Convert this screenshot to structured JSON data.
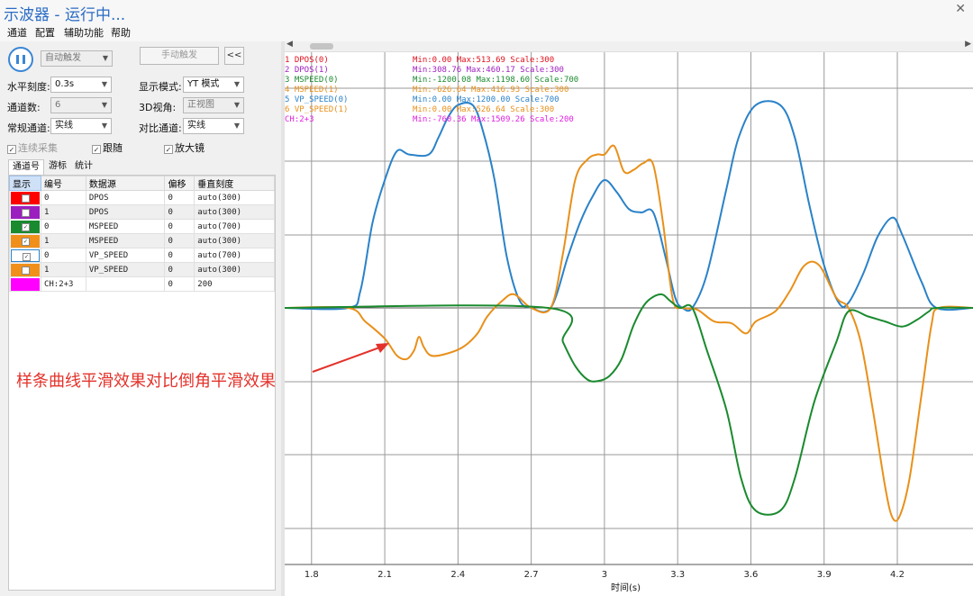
{
  "window": {
    "title": "示波器 - 运行中..."
  },
  "menu": [
    "通道",
    "配置",
    "辅助功能",
    "帮助"
  ],
  "controls": {
    "trigger_mode": "自动触发",
    "manual_trigger": "手动触发",
    "collapse": "<<",
    "h_scale_label": "水平刻度:",
    "h_scale_value": "0.3s",
    "display_mode_label": "显示模式:",
    "display_mode_value": "YT 模式",
    "channels_label": "通道数:",
    "channels_value": "6",
    "view3d_label": "3D视角:",
    "view3d_value": "正视图",
    "normal_ch_label": "常规通道:",
    "normal_ch_value": "实线",
    "compare_ch_label": "对比通道:",
    "compare_ch_value": "实线",
    "continuous": "连续采集",
    "follow": "跟随",
    "magnifier": "放大镜"
  },
  "tabs": [
    "通道号",
    "游标",
    "统计"
  ],
  "table": {
    "headers": [
      "显示",
      "编号",
      "数据源",
      "偏移",
      "垂直刻度"
    ],
    "rows": [
      {
        "color": "#ff0000",
        "checked": false,
        "num": "0",
        "source": "DPOS",
        "offset": "0",
        "scale": "auto(300)"
      },
      {
        "color": "#9b1fbf",
        "checked": false,
        "num": "1",
        "source": "DPOS",
        "offset": "0",
        "scale": "auto(300)"
      },
      {
        "color": "#1a8a2e",
        "checked": true,
        "num": "0",
        "source": "MSPEED",
        "offset": "0",
        "scale": "auto(700)"
      },
      {
        "color": "#f0901a",
        "checked": true,
        "num": "1",
        "source": "MSPEED",
        "offset": "0",
        "scale": "auto(300)"
      },
      {
        "color": "#ffffff",
        "checked": true,
        "num": "0",
        "source": "VP_SPEED",
        "offset": "0",
        "scale": "auto(700)"
      },
      {
        "color": "#f0901a",
        "checked": false,
        "num": "1",
        "source": "VP_SPEED",
        "offset": "0",
        "scale": "auto(300)"
      },
      {
        "color": "#ff00ff",
        "checked": null,
        "num": "CH:2+3",
        "source": "",
        "offset": "0",
        "scale": "200"
      }
    ]
  },
  "legend": [
    {
      "name": "1 DPOS(0)",
      "stats": "Min:0.00  Max:513.69  Scale:300",
      "color": "#e0101c"
    },
    {
      "name": "2 DPOS(1)",
      "stats": "Min:308.76  Max:460.17  Scale:300",
      "color": "#a020c0"
    },
    {
      "name": "3 MSPEED(0)",
      "stats": "Min:-1200.08  Max:1198.60  Scale:700",
      "color": "#1a8a2e"
    },
    {
      "name": "4 MSPEED(1)",
      "stats": "Min:-626.64  Max:416.93  Scale:300",
      "color": "#e8901a"
    },
    {
      "name": "5 VP_SPEED(0)",
      "stats": "Min:0.00  Max:1200.00  Scale:700",
      "color": "#2a82c8"
    },
    {
      "name": "6 VP_SPEED(1)",
      "stats": "Min:0.00  Max:526.64  Scale:300",
      "color": "#e8901a"
    },
    {
      "name": "CH:2+3",
      "stats": "Min:-760.36  Max:1509.26  Scale:200",
      "color": "#e020e0"
    }
  ],
  "annotation": "样条曲线平滑效果对比倒角平滑效果",
  "chart_data": {
    "type": "line",
    "xlabel": "时间(s)",
    "x_ticks": [
      "1.8",
      "2.1",
      "2.4",
      "2.7",
      "3",
      "3.3",
      "3.6",
      "3.9",
      "4.2"
    ],
    "xlim": [
      1.69,
      4.51
    ],
    "ylim": [
      -1500,
      1500
    ],
    "grid": true,
    "series": [
      {
        "name": "5 VP_SPEED(0)",
        "color": "#2a82c8",
        "points": [
          [
            1.69,
            0
          ],
          [
            1.95,
            0
          ],
          [
            2.0,
            100
          ],
          [
            2.05,
            500
          ],
          [
            2.1,
            750
          ],
          [
            2.15,
            920
          ],
          [
            2.2,
            900
          ],
          [
            2.28,
            900
          ],
          [
            2.32,
            1000
          ],
          [
            2.36,
            1120
          ],
          [
            2.4,
            1190
          ],
          [
            2.46,
            1190
          ],
          [
            2.5,
            1050
          ],
          [
            2.55,
            750
          ],
          [
            2.6,
            300
          ],
          [
            2.65,
            50
          ],
          [
            2.7,
            0
          ],
          [
            2.78,
            0
          ],
          [
            2.85,
            300
          ],
          [
            2.9,
            500
          ],
          [
            2.95,
            650
          ],
          [
            3.0,
            750
          ],
          [
            3.05,
            680
          ],
          [
            3.1,
            580
          ],
          [
            3.15,
            560
          ],
          [
            3.2,
            560
          ],
          [
            3.25,
            300
          ],
          [
            3.29,
            60
          ],
          [
            3.32,
            0
          ],
          [
            3.36,
            0
          ],
          [
            3.42,
            200
          ],
          [
            3.5,
            700
          ],
          [
            3.55,
            1000
          ],
          [
            3.62,
            1190
          ],
          [
            3.72,
            1190
          ],
          [
            3.78,
            1000
          ],
          [
            3.84,
            600
          ],
          [
            3.9,
            250
          ],
          [
            3.96,
            30
          ],
          [
            4.0,
            30
          ],
          [
            4.06,
            200
          ],
          [
            4.12,
            420
          ],
          [
            4.18,
            530
          ],
          [
            4.22,
            430
          ],
          [
            4.3,
            150
          ],
          [
            4.36,
            0
          ],
          [
            4.51,
            0
          ]
        ]
      },
      {
        "name": "4 MSPEED(1)",
        "color": "#e8901a",
        "points": [
          [
            1.69,
            0
          ],
          [
            1.95,
            0
          ],
          [
            2.02,
            -80
          ],
          [
            2.1,
            -180
          ],
          [
            2.15,
            -280
          ],
          [
            2.19,
            -300
          ],
          [
            2.22,
            -250
          ],
          [
            2.24,
            -170
          ],
          [
            2.26,
            -230
          ],
          [
            2.29,
            -280
          ],
          [
            2.35,
            -270
          ],
          [
            2.42,
            -230
          ],
          [
            2.48,
            -150
          ],
          [
            2.52,
            -50
          ],
          [
            2.58,
            40
          ],
          [
            2.63,
            80
          ],
          [
            2.7,
            0
          ],
          [
            2.78,
            0
          ],
          [
            2.83,
            320
          ],
          [
            2.88,
            750
          ],
          [
            2.93,
            870
          ],
          [
            2.97,
            900
          ],
          [
            3.0,
            900
          ],
          [
            3.04,
            950
          ],
          [
            3.08,
            800
          ],
          [
            3.12,
            810
          ],
          [
            3.16,
            850
          ],
          [
            3.2,
            840
          ],
          [
            3.24,
            500
          ],
          [
            3.28,
            50
          ],
          [
            3.32,
            0
          ],
          [
            3.38,
            -10
          ],
          [
            3.45,
            -80
          ],
          [
            3.52,
            -90
          ],
          [
            3.58,
            -150
          ],
          [
            3.62,
            -80
          ],
          [
            3.7,
            -20
          ],
          [
            3.76,
            100
          ],
          [
            3.82,
            250
          ],
          [
            3.88,
            250
          ],
          [
            3.95,
            60
          ],
          [
            4.0,
            0
          ],
          [
            4.05,
            -200
          ],
          [
            4.1,
            -600
          ],
          [
            4.15,
            -1050
          ],
          [
            4.18,
            -1230
          ],
          [
            4.21,
            -1220
          ],
          [
            4.25,
            -1000
          ],
          [
            4.3,
            -500
          ],
          [
            4.34,
            -100
          ],
          [
            4.37,
            0
          ],
          [
            4.51,
            0
          ]
        ]
      },
      {
        "name": "3 MSPEED(0)",
        "color": "#1a8a2e",
        "points": [
          [
            1.69,
            0
          ],
          [
            2.77,
            0
          ],
          [
            2.83,
            -200
          ],
          [
            2.88,
            -340
          ],
          [
            2.93,
            -420
          ],
          [
            2.97,
            -430
          ],
          [
            3.02,
            -400
          ],
          [
            3.07,
            -300
          ],
          [
            3.12,
            -100
          ],
          [
            3.17,
            30
          ],
          [
            3.23,
            80
          ],
          [
            3.27,
            40
          ],
          [
            3.31,
            0
          ],
          [
            3.36,
            0
          ],
          [
            3.42,
            -250
          ],
          [
            3.5,
            -600
          ],
          [
            3.56,
            -1000
          ],
          [
            3.62,
            -1190
          ],
          [
            3.72,
            -1190
          ],
          [
            3.78,
            -1000
          ],
          [
            3.86,
            -550
          ],
          [
            3.95,
            -200
          ],
          [
            4.0,
            -20
          ],
          [
            4.08,
            -50
          ],
          [
            4.15,
            -80
          ],
          [
            4.22,
            -110
          ],
          [
            4.28,
            -70
          ],
          [
            4.33,
            -20
          ],
          [
            4.36,
            0
          ],
          [
            4.51,
            0
          ]
        ]
      }
    ]
  }
}
